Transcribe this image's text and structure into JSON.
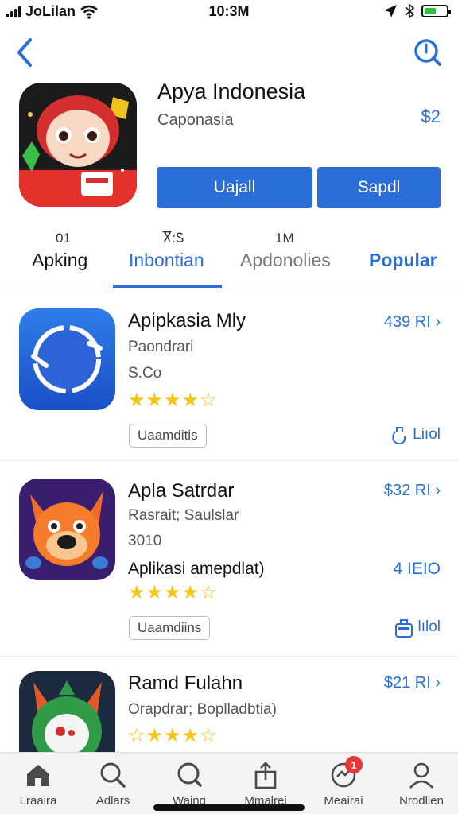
{
  "status_bar": {
    "carrier": "JoLilan",
    "time": "10:3M"
  },
  "header": {
    "back_icon": "chevron-left-icon",
    "search_icon": "search-icon"
  },
  "hero": {
    "title": "Apya Indonesia",
    "subtitle": "Caponasia",
    "price": "$2",
    "primary_button": "Uajall",
    "secondary_button": "Sapdl"
  },
  "tabs": [
    {
      "top": "01",
      "label": "Apking"
    },
    {
      "top": "Ⴟ:Ꮪ",
      "label": "Inbontian"
    },
    {
      "top": "1M",
      "label": "Apdonolies"
    },
    {
      "top": "",
      "label": "Popular"
    }
  ],
  "apps": [
    {
      "name": "Apipkasia Mly",
      "meta1": "Paondrari",
      "meta2": "S.Co",
      "extra": "",
      "side_value": "",
      "price": "439 RI",
      "rating": 4,
      "tag": "Uaamditis",
      "action": "Liıol"
    },
    {
      "name": "Apla Satrdar",
      "meta1": "Rasrait; Saulslar",
      "meta2": "3010",
      "extra": "Aplikasi amepdlat)",
      "side_value": "4 IEIO",
      "price": "$32 RI",
      "rating": 4,
      "tag": "Uaamdiins",
      "action": "lılol"
    },
    {
      "name": "Ramd Fulahn",
      "meta1": "Orapdrar; Boplladbtia)",
      "meta2": "",
      "extra": "",
      "side_value": "",
      "price": "$21 RI",
      "rating": 3,
      "tag": "",
      "action": ""
    }
  ],
  "bottom_nav": [
    {
      "label": "Lraaira",
      "icon": "home-icon"
    },
    {
      "label": "Adlars",
      "icon": "search-icon"
    },
    {
      "label": "Waing",
      "icon": "search-icon"
    },
    {
      "label": "Mmalrei",
      "icon": "share-icon"
    },
    {
      "label": "Meairai",
      "icon": "updates-icon",
      "badge": "1"
    },
    {
      "label": "Nrodlien",
      "icon": "profile-icon"
    }
  ],
  "colors": {
    "accent": "#2a6fd8",
    "star": "#f5c518"
  }
}
